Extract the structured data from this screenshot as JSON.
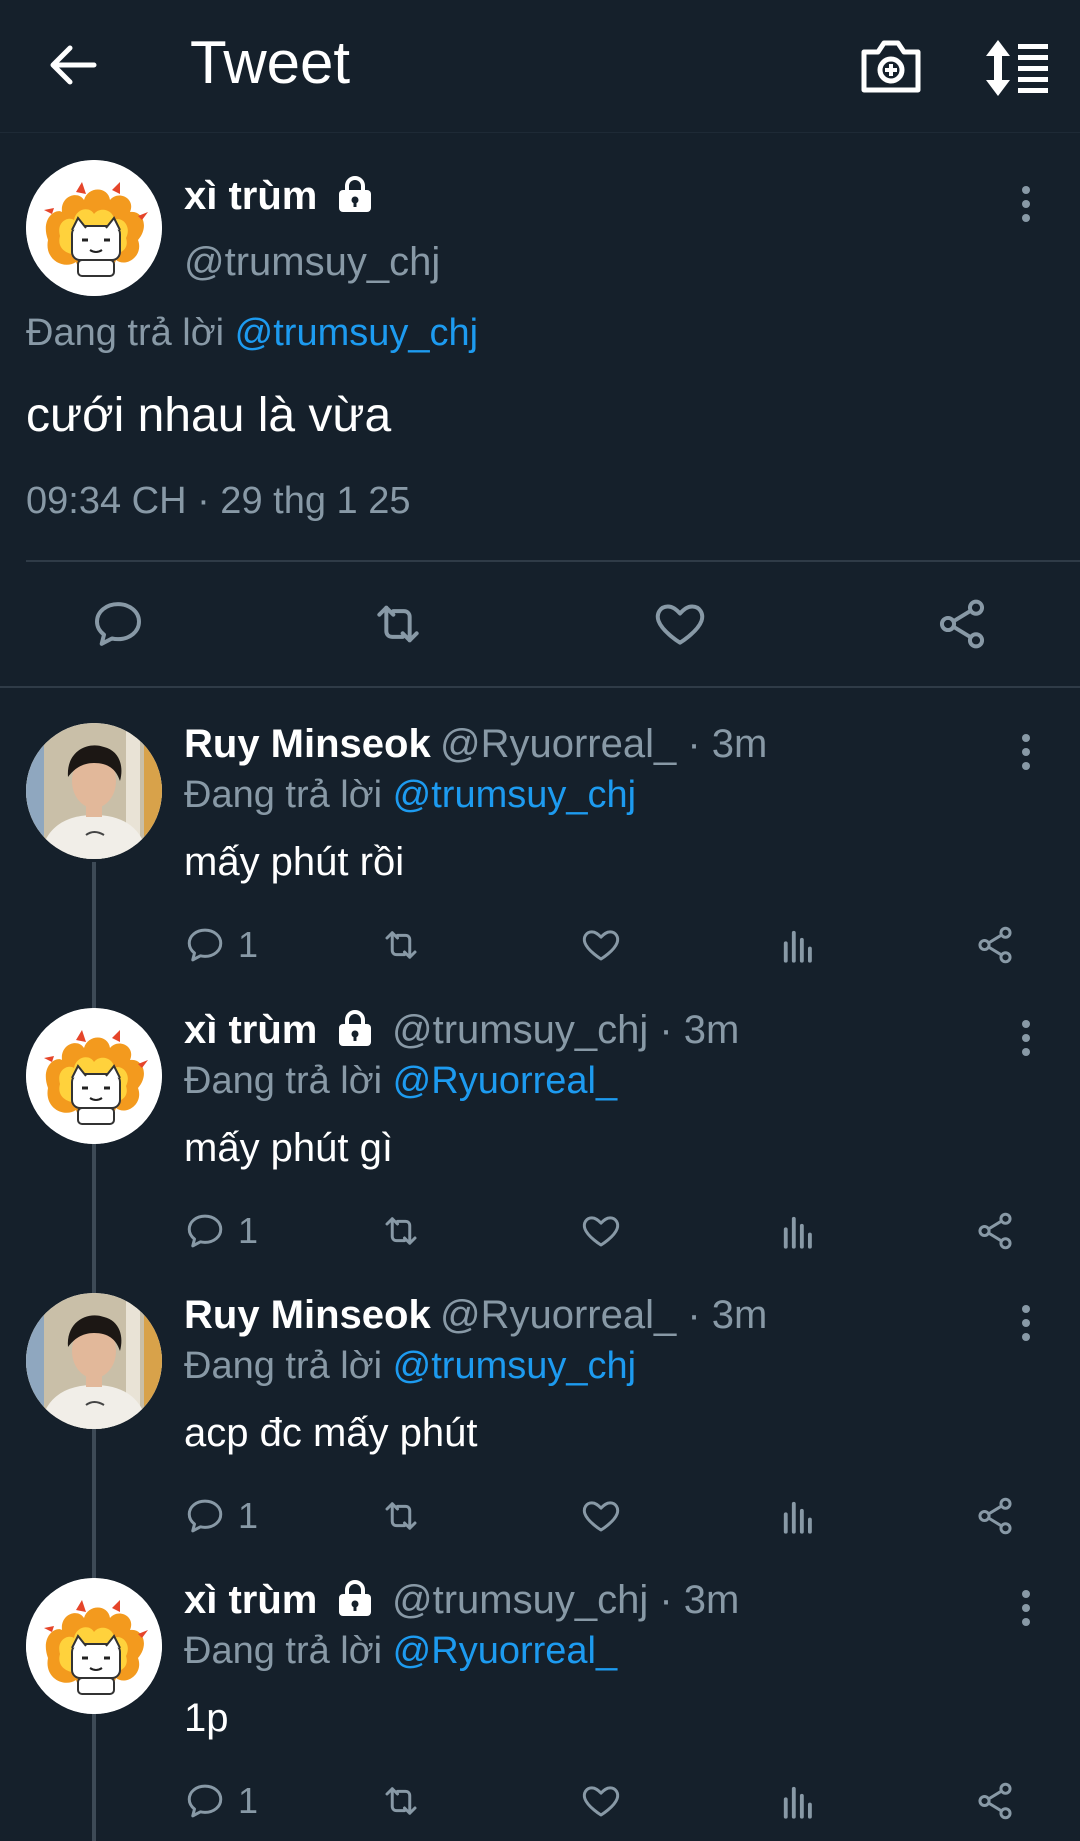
{
  "header": {
    "title": "Tweet"
  },
  "main_tweet": {
    "name": "xì trùm",
    "handle": "@trumsuy_chj",
    "reply_prefix": "Đang trả lời",
    "reply_mention": "@trumsuy_chj",
    "text": "cưới nhau là vừa",
    "timestamp": "09:34 CH · 29 thg 1 25"
  },
  "replies": [
    {
      "name": "Ruy Minseok",
      "handle": "@Ryuorreal_ · 3m",
      "reply_prefix": "Đang trả lời",
      "reply_mention": "@trumsuy_chj",
      "text": "mấy phút rồi",
      "reply_count": "1"
    },
    {
      "name": "xì trùm",
      "handle": "@trumsuy_chj · 3m",
      "reply_prefix": "Đang trả lời",
      "reply_mention": "@Ryuorreal_",
      "text": "mấy phút gì",
      "reply_count": "1"
    },
    {
      "name": "Ruy Minseok",
      "handle": "@Ryuorreal_ · 3m",
      "reply_prefix": "Đang trả lời",
      "reply_mention": "@trumsuy_chj",
      "text": "acp đc mấy phút",
      "reply_count": "1"
    },
    {
      "name": "xì trùm",
      "handle": "@trumsuy_chj · 3m",
      "reply_prefix": "Đang trả lời",
      "reply_mention": "@Ryuorreal_",
      "text": "1p",
      "reply_count": "1"
    }
  ],
  "colors": {
    "background": "#15202b",
    "mention": "#1d9bf0",
    "muted": "#8899a6"
  },
  "icons": [
    "back-arrow-icon",
    "camera-plus-icon",
    "sort-icon",
    "lock-icon",
    "more-icon",
    "reply-icon",
    "retweet-icon",
    "like-icon",
    "share-icon",
    "analytics-icon"
  ]
}
